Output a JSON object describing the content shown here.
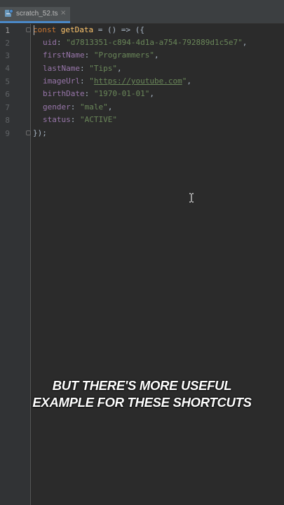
{
  "editor": {
    "tab": {
      "title": "scratch_52.ts",
      "icon": "typescript-file-icon",
      "close_glyph": "×"
    },
    "line_numbers": [
      "1",
      "2",
      "3",
      "4",
      "5",
      "6",
      "7",
      "8",
      "9"
    ],
    "code": {
      "l1": {
        "kw": "const",
        "fn": "getData",
        "rest": " = () => ({"
      },
      "l2": {
        "prop": "uid",
        "sep": ": ",
        "value": "\"d7813351-c894-4d1a-a754-792889d1c5e7\"",
        "end": ","
      },
      "l3": {
        "prop": "firstName",
        "sep": ": ",
        "value": "\"Programmers\"",
        "end": ","
      },
      "l4": {
        "prop": "lastName",
        "sep": ": ",
        "value": "\"Tips\"",
        "end": ","
      },
      "l5": {
        "prop": "imageUrl",
        "sep": ": ",
        "q1": "\"",
        "url": "https://youtube.com",
        "q2": "\"",
        "end": ","
      },
      "l6": {
        "prop": "birthDate",
        "sep": ": ",
        "value": "\"1970-01-01\"",
        "end": ","
      },
      "l7": {
        "prop": "gender",
        "sep": ": ",
        "value": "\"male\"",
        "end": ","
      },
      "l8": {
        "prop": "status",
        "sep": ": ",
        "value": "\"ACTIVE\""
      },
      "l9": {
        "text": "});"
      }
    }
  },
  "caption": {
    "line1": "BUT THERE'S MORE USEFUL",
    "line2": "EXAMPLE FOR THESE SHORTCUTS"
  },
  "colors": {
    "background": "#2b2b2b",
    "keyword": "#cc7832",
    "function": "#ffc66d",
    "property": "#9876aa",
    "string": "#6a8759",
    "tab_accent": "#4a88c7"
  }
}
